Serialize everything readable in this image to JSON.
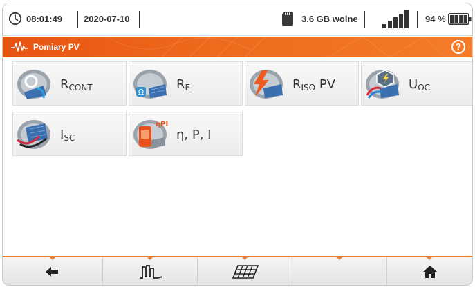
{
  "status_bar": {
    "time": "08:01:49",
    "date": "2020-07-10",
    "storage": "3.6 GB wolne",
    "signal_icon": "signal-bars-icon",
    "battery_percent": "94 %",
    "battery_level": 0.94
  },
  "header": {
    "icon": "pv-waveform-icon",
    "title": "Pomiary PV",
    "help_label": "?"
  },
  "tiles": [
    {
      "main": "R",
      "sub": "CONT",
      "suffix": "",
      "icon": "continuity-meter-icon"
    },
    {
      "main": "R",
      "sub": "E",
      "suffix": "",
      "icon": "earth-resistance-icon"
    },
    {
      "main": "R",
      "sub": "ISO",
      "suffix": " PV",
      "icon": "insulation-lightning-icon"
    },
    {
      "main": "U",
      "sub": "OC",
      "suffix": "",
      "icon": "open-circuit-voltage-icon"
    },
    {
      "main": "I",
      "sub": "SC",
      "suffix": "",
      "icon": "short-circuit-current-icon"
    },
    {
      "main": "η, P, I",
      "sub": "",
      "suffix": "",
      "icon": "efficiency-power-icon"
    }
  ],
  "toolbar": {
    "buttons": [
      {
        "icon": "back-arrow-icon"
      },
      {
        "icon": "waveform-filter-icon"
      },
      {
        "icon": "solar-panel-icon"
      },
      {
        "icon": "empty"
      },
      {
        "icon": "home-icon"
      }
    ]
  },
  "colors": {
    "accent": "#ef7c24",
    "header": "#e85410",
    "tile_bg": "#eeeeee",
    "text": "#333333"
  }
}
